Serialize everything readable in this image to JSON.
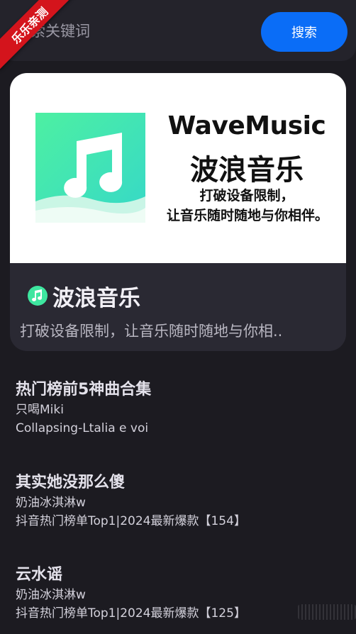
{
  "ribbon": {
    "label": "乐乐亲测"
  },
  "search": {
    "placeholder": "搜索关键词",
    "button_label": "搜索"
  },
  "featured": {
    "banner": {
      "brand": "WaveMusic",
      "title": "波浪音乐",
      "line1": "打破设备限制，",
      "line2": "让音乐随时随地与你相伴。"
    },
    "app_name": "波浪音乐",
    "description": "打破设备限制，让音乐随时随地与你相.."
  },
  "songs": [
    {
      "title": "热门榜前5神曲合集",
      "artist": "只喝Miki",
      "album": "Collapsing-Ltalia e voi"
    },
    {
      "title": "其实她没那么傻",
      "artist": "奶油冰淇淋w",
      "album": "抖音热门榜单Top1|2024最新爆款【154】"
    },
    {
      "title": "云水谣",
      "artist": "奶油冰淇淋w",
      "album": "抖音热门榜单Top1|2024最新爆款【125】"
    }
  ],
  "colors": {
    "background": "#1c1b21",
    "accent": "#0a6df7",
    "ribbon": "#d4141c",
    "logo_green": "#3ee6a0"
  },
  "icons": {
    "logo": "music-note-icon",
    "app_badge": "music-note-icon"
  }
}
